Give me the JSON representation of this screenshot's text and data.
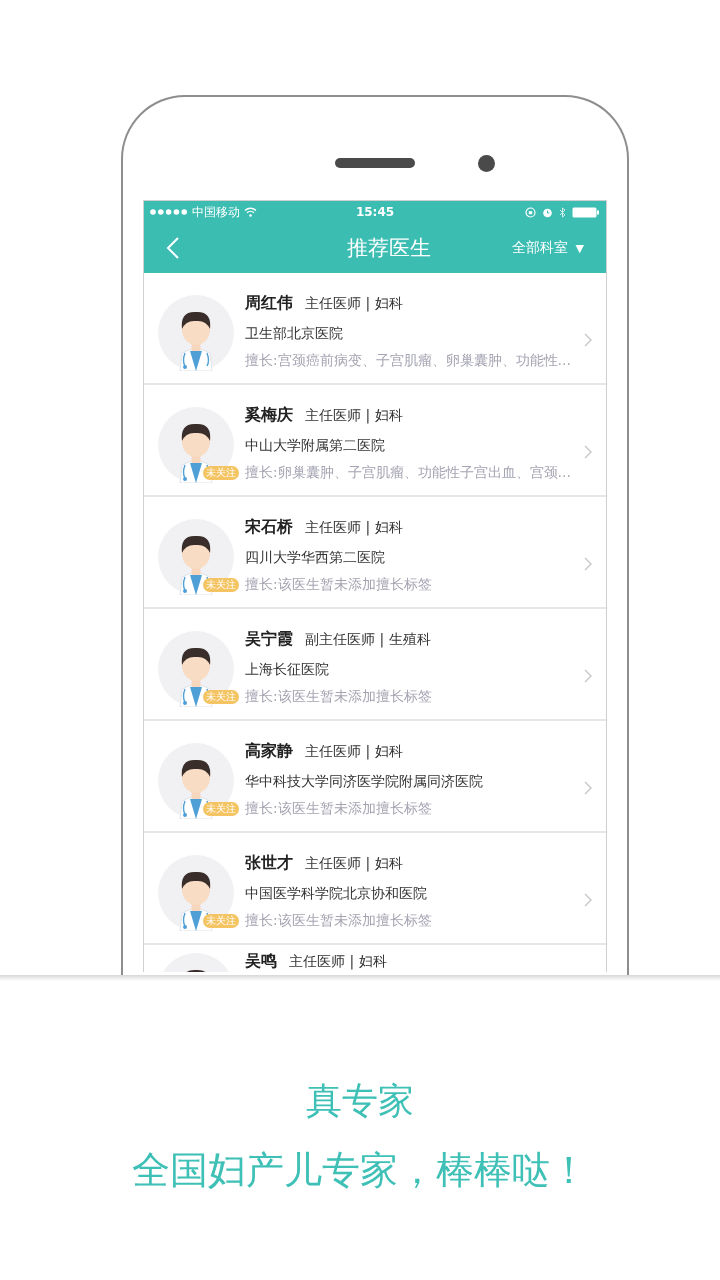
{
  "status_bar": {
    "carrier": "中国移动",
    "time": "15:45"
  },
  "nav": {
    "title": "推荐医生",
    "filter": "全部科室",
    "filter_caret": "▼"
  },
  "doctors": [
    {
      "name": "周红伟",
      "title": "主任医师 | 妇科",
      "hospital": "卫生部北京医院",
      "specialty": "擅长:宫颈癌前病变、子宫肌瘤、卵巢囊肿、功能性…"
    },
    {
      "name": "奚梅庆",
      "title": "主任医师 | 妇科",
      "hospital": "中山大学附属第二医院",
      "specialty": "擅长:卵巢囊肿、子宫肌瘤、功能性子宫出血、宫颈…",
      "badge": "未关注"
    },
    {
      "name": "宋石桥",
      "title": "主任医师 | 妇科",
      "hospital": "四川大学华西第二医院",
      "specialty": "擅长:该医生暂未添加擅长标签",
      "badge": "未关注"
    },
    {
      "name": "吴宁霞",
      "title": "副主任医师 | 生殖科",
      "hospital": "上海长征医院",
      "specialty": "擅长:该医生暂未添加擅长标签",
      "badge": "未关注"
    },
    {
      "name": "高家静",
      "title": "主任医师 | 妇科",
      "hospital": "华中科技大学同济医学院附属同济医院",
      "specialty": "擅长:该医生暂未添加擅长标签",
      "badge": "未关注"
    },
    {
      "name": "张世才",
      "title": "主任医师 | 妇科",
      "hospital": "中国医学科学院北京协和医院",
      "specialty": "擅长:该医生暂未添加擅长标签",
      "badge": "未关注"
    },
    {
      "name": "吴鸣",
      "title": "主任医师 | 妇科"
    }
  ],
  "tagline": {
    "title": "真专家",
    "subtitle": "全国妇产儿专家，棒棒哒！"
  }
}
